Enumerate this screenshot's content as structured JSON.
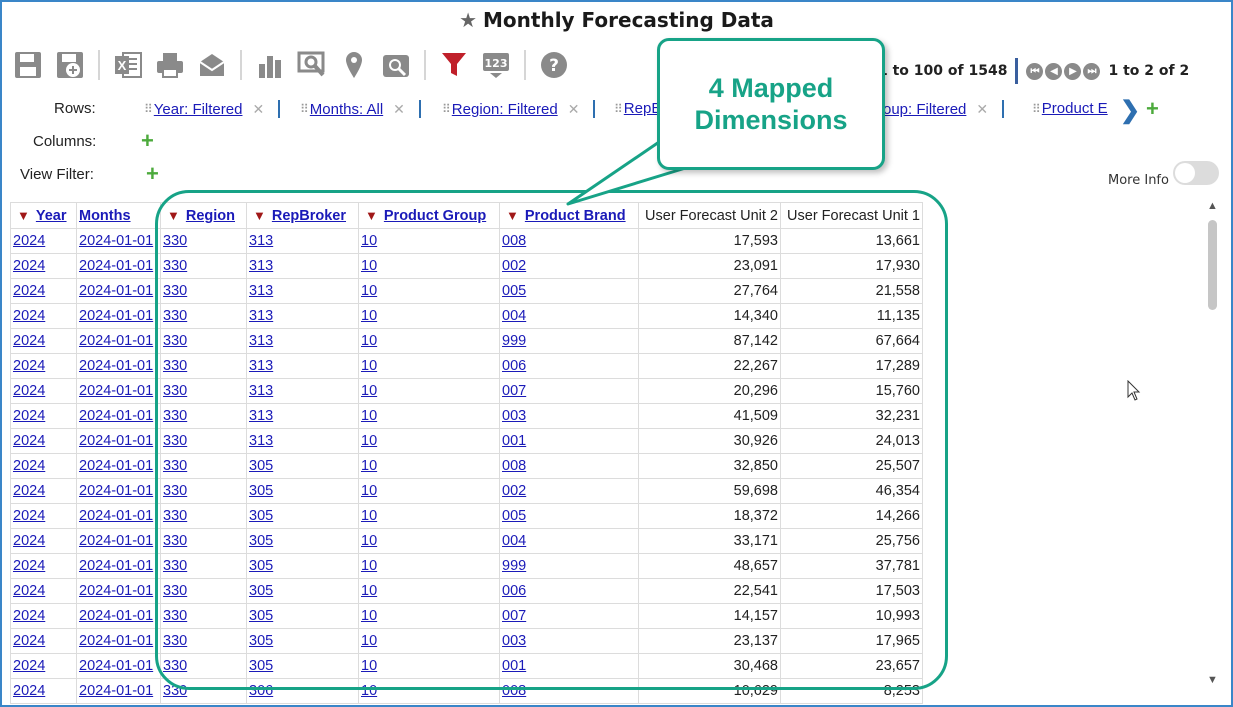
{
  "title": "Monthly Forecasting Data",
  "toolbar": {
    "icons": [
      "save-icon",
      "save-as-icon",
      "excel-export-icon",
      "print-icon",
      "email-icon",
      "chart-icon",
      "search-icon",
      "map-pin-icon",
      "zoom-icon",
      "filter-icon",
      "number-format-icon",
      "help-icon"
    ],
    "filter_color": "#c0202a"
  },
  "pager": {
    "records": "1 to 100 of 1548",
    "pages": "1 to 2 of 2"
  },
  "labels": {
    "rows": "Rows:",
    "columns": "Columns:",
    "view_filter": "View Filter:",
    "more_info": "More Info"
  },
  "row_dims": [
    {
      "label": "Year: Filtered"
    },
    {
      "label": "Months: All"
    },
    {
      "label": "Region: Filtered"
    },
    {
      "label": "RepB"
    },
    {
      "label": "roup: Filtered"
    },
    {
      "label": "Product E"
    }
  ],
  "callout": {
    "line1": "4 Mapped",
    "line2": "Dimensions"
  },
  "table": {
    "headers": [
      "Year",
      "Months",
      "Region",
      "RepBroker",
      "Product Group",
      "Product Brand",
      "User Forecast Unit 2",
      "User Forecast Unit 1"
    ],
    "rows": [
      [
        "2024",
        "2024-01-01",
        "330",
        "313",
        "10",
        "008",
        "17,593",
        "13,661"
      ],
      [
        "2024",
        "2024-01-01",
        "330",
        "313",
        "10",
        "002",
        "23,091",
        "17,930"
      ],
      [
        "2024",
        "2024-01-01",
        "330",
        "313",
        "10",
        "005",
        "27,764",
        "21,558"
      ],
      [
        "2024",
        "2024-01-01",
        "330",
        "313",
        "10",
        "004",
        "14,340",
        "11,135"
      ],
      [
        "2024",
        "2024-01-01",
        "330",
        "313",
        "10",
        "999",
        "87,142",
        "67,664"
      ],
      [
        "2024",
        "2024-01-01",
        "330",
        "313",
        "10",
        "006",
        "22,267",
        "17,289"
      ],
      [
        "2024",
        "2024-01-01",
        "330",
        "313",
        "10",
        "007",
        "20,296",
        "15,760"
      ],
      [
        "2024",
        "2024-01-01",
        "330",
        "313",
        "10",
        "003",
        "41,509",
        "32,231"
      ],
      [
        "2024",
        "2024-01-01",
        "330",
        "313",
        "10",
        "001",
        "30,926",
        "24,013"
      ],
      [
        "2024",
        "2024-01-01",
        "330",
        "305",
        "10",
        "008",
        "32,850",
        "25,507"
      ],
      [
        "2024",
        "2024-01-01",
        "330",
        "305",
        "10",
        "002",
        "59,698",
        "46,354"
      ],
      [
        "2024",
        "2024-01-01",
        "330",
        "305",
        "10",
        "005",
        "18,372",
        "14,266"
      ],
      [
        "2024",
        "2024-01-01",
        "330",
        "305",
        "10",
        "004",
        "33,171",
        "25,756"
      ],
      [
        "2024",
        "2024-01-01",
        "330",
        "305",
        "10",
        "999",
        "48,657",
        "37,781"
      ],
      [
        "2024",
        "2024-01-01",
        "330",
        "305",
        "10",
        "006",
        "22,541",
        "17,503"
      ],
      [
        "2024",
        "2024-01-01",
        "330",
        "305",
        "10",
        "007",
        "14,157",
        "10,993"
      ],
      [
        "2024",
        "2024-01-01",
        "330",
        "305",
        "10",
        "003",
        "23,137",
        "17,965"
      ],
      [
        "2024",
        "2024-01-01",
        "330",
        "305",
        "10",
        "001",
        "30,468",
        "23,657"
      ],
      [
        "2024",
        "2024-01-01",
        "330",
        "306",
        "10",
        "008",
        "10,629",
        "8,253"
      ]
    ]
  },
  "colors": {
    "link": "#1a1ab8",
    "accent_green": "#17a387",
    "filter_red": "#a01818",
    "border_blue": "#3a86c8"
  }
}
